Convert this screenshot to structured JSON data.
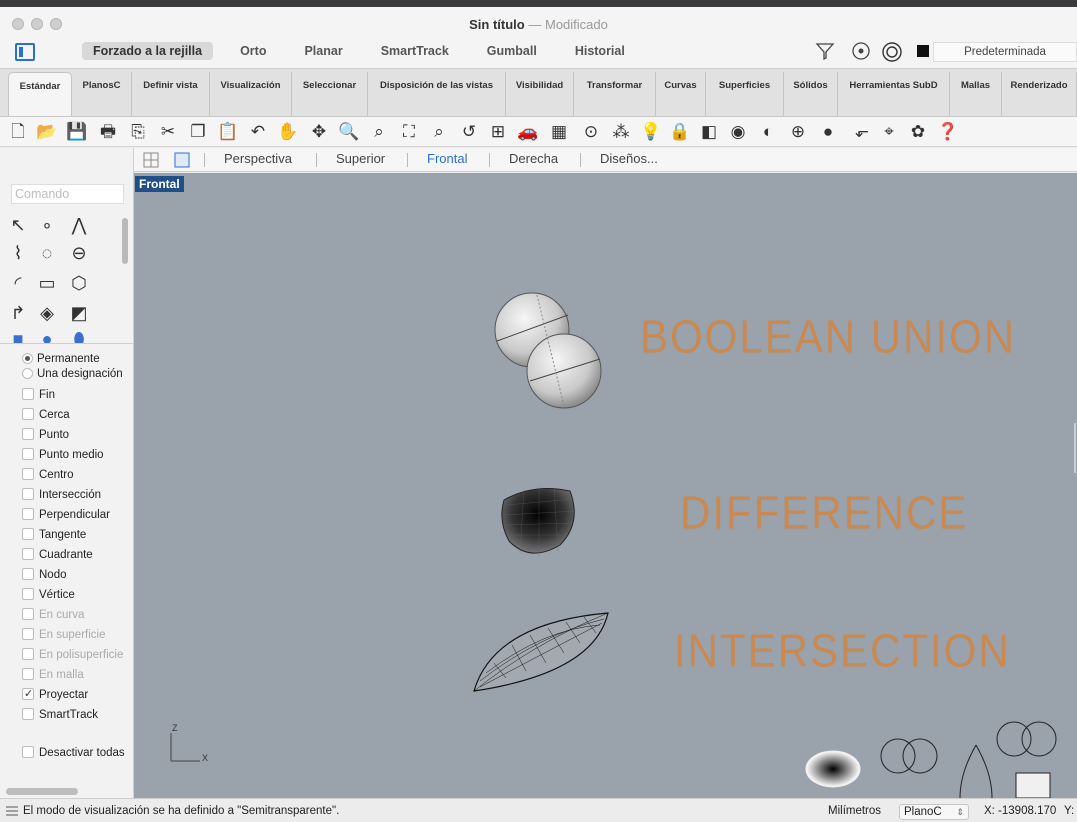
{
  "window": {
    "title": "Sin título",
    "separator": "—",
    "status": "Modificado"
  },
  "modes": [
    "Forzado a la rejilla",
    "Orto",
    "Planar",
    "SmartTrack",
    "Gumball",
    "Historial"
  ],
  "layer": "Predeterminada",
  "tabs": [
    "Estándar",
    "PlanosC",
    "Definir vista",
    "Visualización",
    "Seleccionar",
    "Disposición de las vistas",
    "Visibilidad",
    "Transformar",
    "Curvas",
    "Superficies",
    "Sólidos",
    "Herramientas SubD",
    "Mallas",
    "Renderizado"
  ],
  "viewtabs": [
    "Perspectiva",
    "Superior",
    "Frontal",
    "Derecha",
    "Diseños..."
  ],
  "active_view": "Frontal",
  "command": {
    "placeholder": "Comando"
  },
  "osnap": {
    "permanente": "Permanente",
    "una": "Una designación",
    "items": [
      {
        "label": "Fin",
        "checked": false,
        "disabled": false
      },
      {
        "label": "Cerca",
        "checked": false,
        "disabled": false
      },
      {
        "label": "Punto",
        "checked": false,
        "disabled": false
      },
      {
        "label": "Punto medio",
        "checked": false,
        "disabled": false
      },
      {
        "label": "Centro",
        "checked": false,
        "disabled": false
      },
      {
        "label": "Intersección",
        "checked": false,
        "disabled": false
      },
      {
        "label": "Perpendicular",
        "checked": false,
        "disabled": false
      },
      {
        "label": "Tangente",
        "checked": false,
        "disabled": false
      },
      {
        "label": "Cuadrante",
        "checked": false,
        "disabled": false
      },
      {
        "label": "Nodo",
        "checked": false,
        "disabled": false
      },
      {
        "label": "Vértice",
        "checked": false,
        "disabled": false
      },
      {
        "label": "En curva",
        "checked": false,
        "disabled": true
      },
      {
        "label": "En superficie",
        "checked": false,
        "disabled": true
      },
      {
        "label": "En polisuperficie",
        "checked": false,
        "disabled": true
      },
      {
        "label": "En malla",
        "checked": false,
        "disabled": true
      },
      {
        "label": "Proyectar",
        "checked": true,
        "disabled": false
      },
      {
        "label": "SmartTrack",
        "checked": false,
        "disabled": false
      }
    ],
    "disable_all": "Desactivar todas"
  },
  "viewport": {
    "label": "Frontal",
    "annotations": [
      "BOOLEAN UNION",
      "DIFFERENCE",
      "INTERSECTION"
    ],
    "axis_z": "Z",
    "axis_x": "X"
  },
  "status": {
    "message": "El modo de visualización se ha definido a \"Semitransparente\".",
    "units": "Milímetros",
    "cplane": "PlanoC",
    "x": "X: -13908.170",
    "y": "Y:"
  }
}
